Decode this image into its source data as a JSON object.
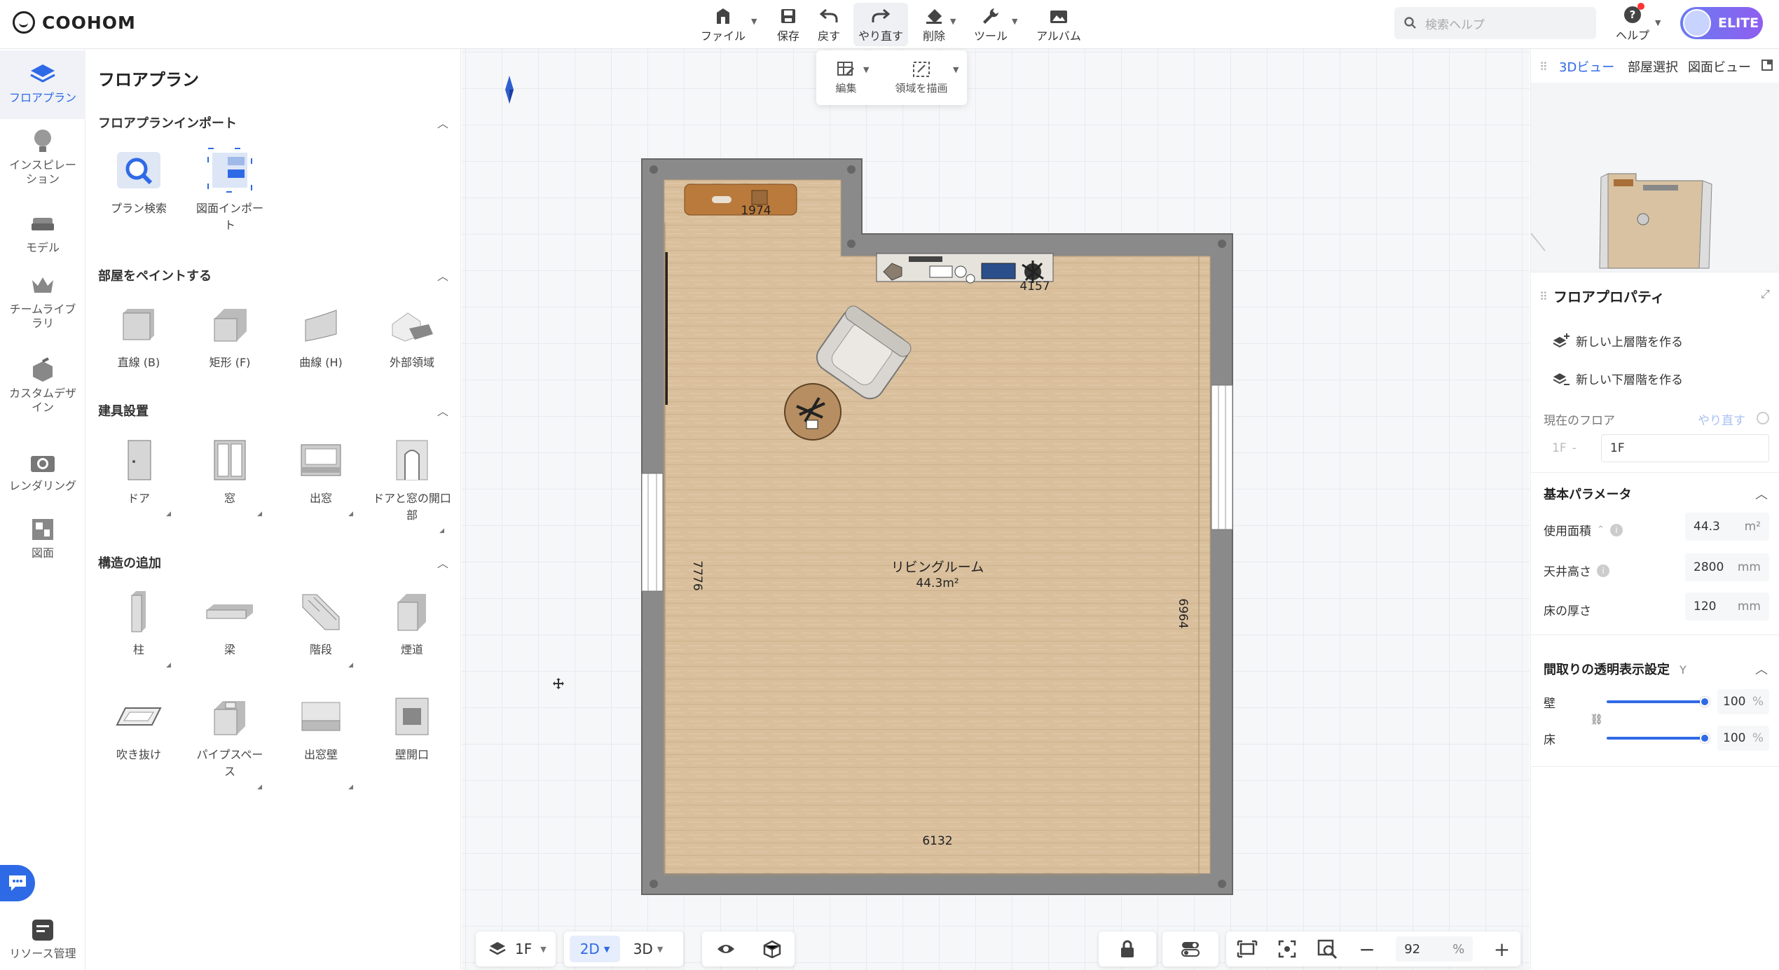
{
  "app": {
    "brand": "COOHOM"
  },
  "toolbar": {
    "items": [
      {
        "label": "ファイル"
      },
      {
        "label": "保存"
      },
      {
        "label": "戻す"
      },
      {
        "label": "やり直す"
      },
      {
        "label": "削除"
      },
      {
        "label": "ツール"
      },
      {
        "label": "アルバム"
      }
    ]
  },
  "search": {
    "placeholder": "検索ヘルプ"
  },
  "help": {
    "label": "ヘルプ"
  },
  "account": {
    "plan": "ELITE"
  },
  "rail": {
    "items": [
      {
        "label": "フロアプラン",
        "icon": "floorplan-icon"
      },
      {
        "label": "インスピレーション",
        "icon": "lightbulb-icon"
      },
      {
        "label": "モデル",
        "icon": "sofa-icon"
      },
      {
        "label": "チームライブラリ",
        "icon": "crown-icon"
      },
      {
        "label": "カスタムデザイン",
        "icon": "custom-box-icon"
      },
      {
        "label": "レンダリング",
        "icon": "camera-icon"
      },
      {
        "label": "図面",
        "icon": "drawing-icon"
      }
    ],
    "bottom": "リソース管理"
  },
  "panel": {
    "title": "フロアプラン",
    "import": {
      "heading": "フロアプランインポート",
      "items": [
        "プラン検索",
        "図面インポート"
      ]
    },
    "paint": {
      "heading": "部屋をペイントする",
      "items": [
        "直線 (B)",
        "矩形 (F)",
        "曲線 (H)",
        "外部領域"
      ]
    },
    "fixtures": {
      "heading": "建具設置",
      "items": [
        "ドア",
        "窓",
        "出窓",
        "ドアと窓の開口部"
      ]
    },
    "structure": {
      "heading": "構造の追加",
      "items": [
        "柱",
        "梁",
        "階段",
        "煙道",
        "吹き抜け",
        "パイプスペース",
        "出窓壁",
        "壁開口"
      ]
    }
  },
  "editbar": {
    "edit": "編集",
    "draw": "領域を描画"
  },
  "plan": {
    "room_name": "リビングルーム",
    "room_area": "44.3m²",
    "dims": {
      "top_cabinet": "1974",
      "tv_unit": "4157",
      "left": "7776",
      "right": "6964",
      "bottom": "6132"
    }
  },
  "bottombar": {
    "floor": "1F",
    "view2d": "2D",
    "view3d": "3D",
    "zoom": "92",
    "zoom_unit": "%"
  },
  "right": {
    "tabs": [
      "3Dビュー",
      "部屋選択",
      "図面ビュー"
    ],
    "props_title": "フロアプロパティ",
    "add_upper": "新しい上層階を作る",
    "add_lower": "新しい下層階を作る",
    "current_floor_label": "現在のフロア",
    "redo_link": "やり直す",
    "floor_prefix": "1F",
    "floor_value": "1F",
    "basic": {
      "heading": "基本パラメータ",
      "area": {
        "label": "使用面積",
        "value": "44.3",
        "unit": "m²"
      },
      "ceiling": {
        "label": "天井高さ",
        "value": "2800",
        "unit": "mm"
      },
      "thickness": {
        "label": "床の厚さ",
        "value": "120",
        "unit": "mm"
      }
    },
    "transparency": {
      "heading": "間取りの透明表示設定",
      "shortcut": "Y",
      "wall": {
        "label": "壁",
        "value": "100",
        "unit": "%",
        "level": 1.0
      },
      "floor": {
        "label": "床",
        "value": "100",
        "unit": "%",
        "level": 1.0
      }
    }
  }
}
